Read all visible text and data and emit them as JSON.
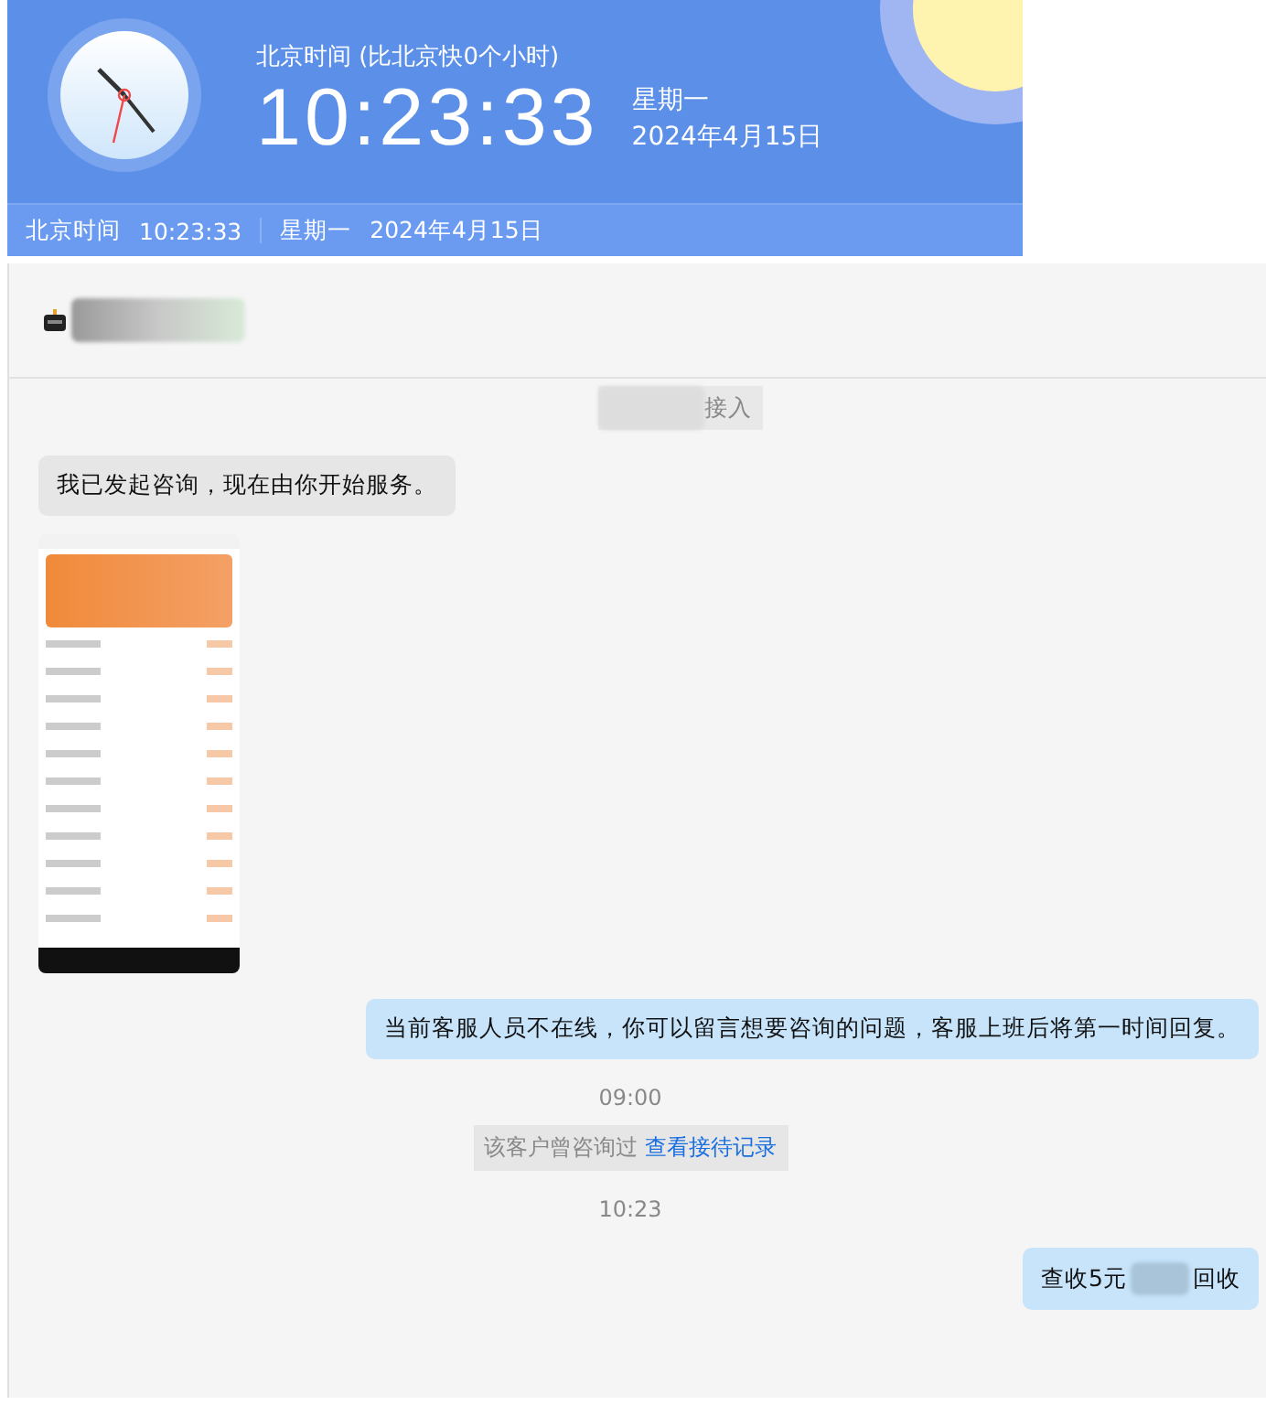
{
  "clock_panel": {
    "caption": "北京时间 (比北京快0个小时)",
    "time": "10:23:33",
    "weekday": "星期一",
    "date": "2024年4月15日"
  },
  "clock_bar": {
    "label": "北京时间",
    "time": "10:23:33",
    "weekday": "星期一",
    "date": "2024年4月15日"
  },
  "chat": {
    "notice": "接入",
    "messages": [
      {
        "kind": "incoming",
        "text": "我已发起咨询，现在由你开始服务。"
      },
      {
        "kind": "image"
      },
      {
        "kind": "outgoing",
        "text": "当前客服人员不在线，你可以留言想要咨询的问题，客服上班后将第一时间回复。"
      },
      {
        "kind": "time",
        "text": "09:00"
      },
      {
        "kind": "system",
        "text": "该客户曾咨询过",
        "link": "查看接待记录"
      },
      {
        "kind": "time",
        "text": "10:23"
      },
      {
        "kind": "outgoing_redacted",
        "text": "查收5元",
        "text_after": "回收"
      }
    ]
  }
}
